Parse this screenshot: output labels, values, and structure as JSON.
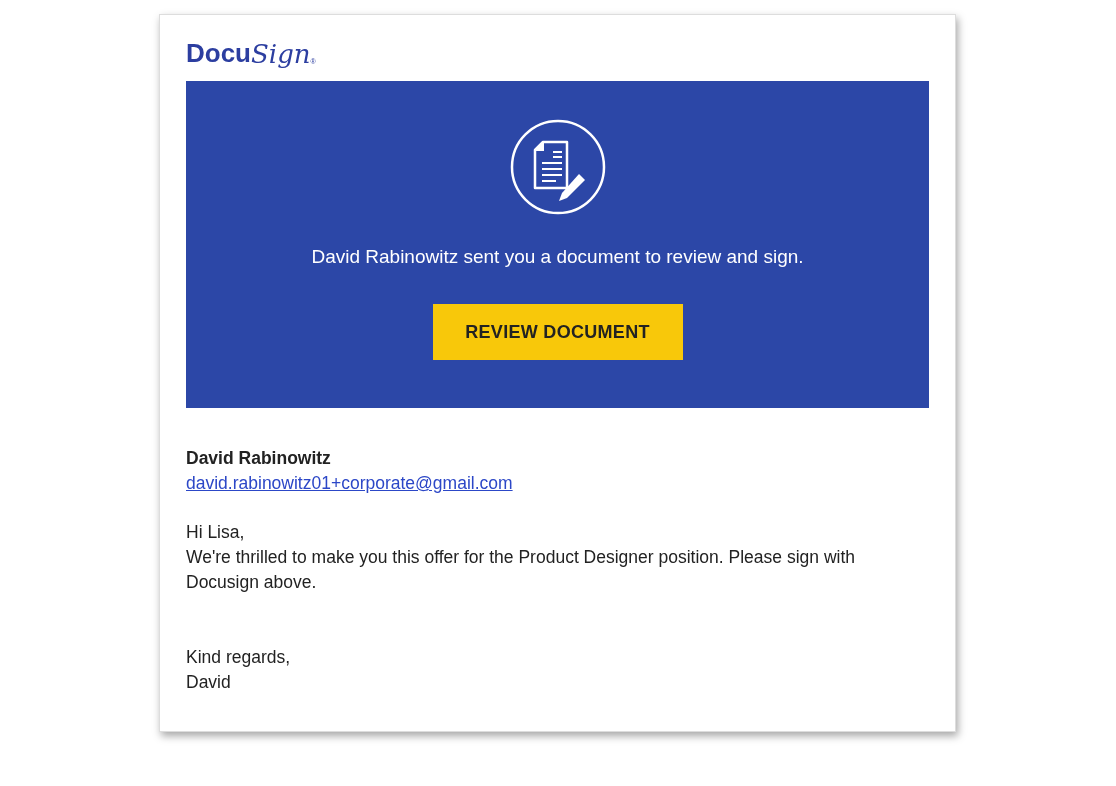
{
  "logo": {
    "word": "Docu",
    "script": "Sign",
    "mark": "®"
  },
  "banner": {
    "message": "David Rabinowitz sent you a document to review and sign.",
    "button": "REVIEW DOCUMENT"
  },
  "sender": {
    "name": "David Rabinowitz",
    "email": "david.rabinowitz01+corporate@gmail.com"
  },
  "body": {
    "greeting": "Hi Lisa,",
    "message": "We're thrilled to make you this offer for the Product Designer position. Please sign with Docusign above.",
    "closing": "Kind regards,",
    "signature": "David"
  }
}
